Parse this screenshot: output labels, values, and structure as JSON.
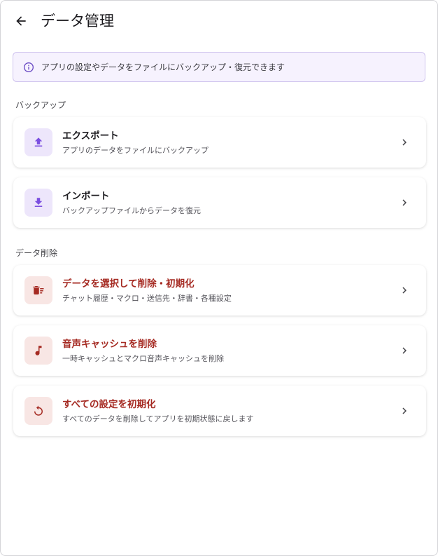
{
  "header": {
    "title": "データ管理",
    "back_icon": "arrow-left-icon"
  },
  "info_banner": {
    "icon": "info-icon",
    "text": "アプリの設定やデータをファイルにバックアップ・復元できます",
    "background": "#f6f2fe",
    "border": "#cfc3ee"
  },
  "sections": {
    "backup": {
      "label": "バックアップ",
      "items": [
        {
          "title": "エクスポート",
          "subtitle": "アプリのデータをファイルにバックアップ",
          "icon": "upload-icon"
        },
        {
          "title": "インポート",
          "subtitle": "バックアップファイルからデータを復元",
          "icon": "download-icon"
        }
      ]
    },
    "delete": {
      "label": "データ削除",
      "items": [
        {
          "title": "データを選択して削除・初期化",
          "subtitle": "チャット履歴・マクロ・送信先・辞書・各種設定",
          "icon": "delete-sweep-icon"
        },
        {
          "title": "音声キャッシュを削除",
          "subtitle": "一時キャッシュとマクロ音声キャッシュを削除",
          "icon": "music-note-icon"
        },
        {
          "title": "すべての設定を初期化",
          "subtitle": "すべてのデータを削除してアプリを初期状態に戻します",
          "icon": "restart-icon"
        }
      ]
    }
  },
  "colors": {
    "accent_purple": "#7b4fe0",
    "icon_bg_purple": "#ede6fb",
    "danger_red": "#a52a22",
    "icon_bg_red": "#f8e6e4"
  }
}
